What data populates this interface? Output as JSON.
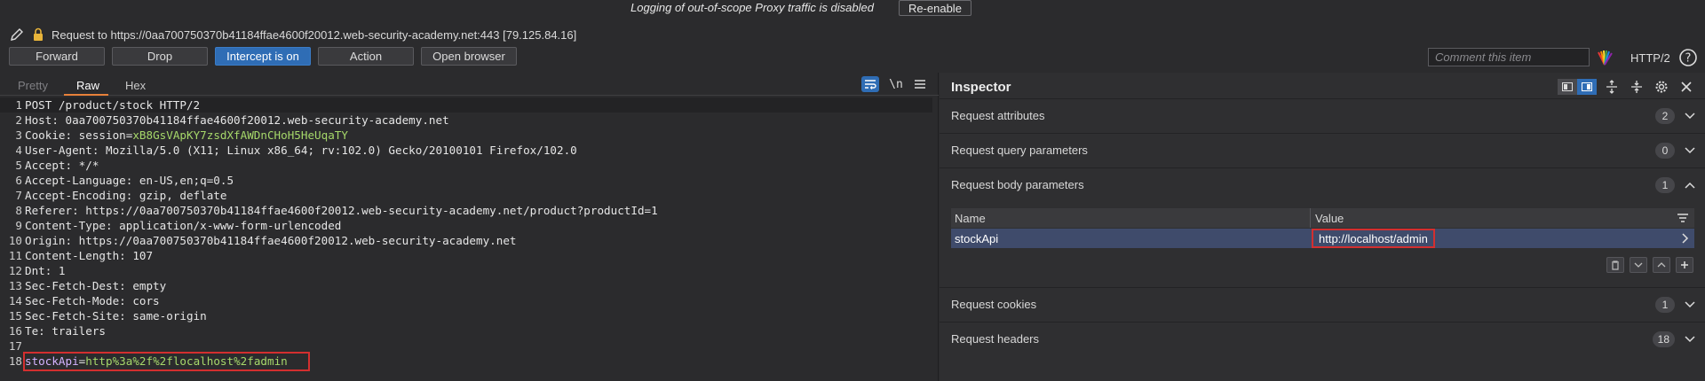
{
  "notice": {
    "text": "Logging of out-of-scope Proxy traffic is disabled",
    "reenable_label": "Re-enable"
  },
  "request": {
    "line": "Request to https://0aa700750370b41184ffae4600f20012.web-security-academy.net:443  [79.125.84.16]"
  },
  "toolbar": {
    "forward": "Forward",
    "drop": "Drop",
    "intercept": "Intercept is on",
    "action": "Action",
    "open_browser": "Open browser",
    "comment_placeholder": "Comment this item",
    "protocol": "HTTP/2"
  },
  "editor": {
    "tabs": [
      "Pretty",
      "Raw",
      "Hex"
    ],
    "active_tab": "Raw",
    "newline_label": "\\n",
    "lines": [
      {
        "n": "1",
        "text": "POST /product/stock HTTP/2"
      },
      {
        "n": "2",
        "text": "Host: 0aa700750370b41184ffae4600f20012.web-security-academy.net"
      },
      {
        "n": "3",
        "key": "Cookie: session=",
        "value": "xB8GsVApKY7zsdXfAWDnCHoH5HeUqaTY"
      },
      {
        "n": "4",
        "text": "User-Agent: Mozilla/5.0 (X11; Linux x86_64; rv:102.0) Gecko/20100101 Firefox/102.0"
      },
      {
        "n": "5",
        "text": "Accept: */*"
      },
      {
        "n": "6",
        "text": "Accept-Language: en-US,en;q=0.5"
      },
      {
        "n": "7",
        "text": "Accept-Encoding: gzip, deflate"
      },
      {
        "n": "8",
        "text": "Referer: https://0aa700750370b41184ffae4600f20012.web-security-academy.net/product?productId=1"
      },
      {
        "n": "9",
        "text": "Content-Type: application/x-www-form-urlencoded"
      },
      {
        "n": "10",
        "text": "Origin: https://0aa700750370b41184ffae4600f20012.web-security-academy.net"
      },
      {
        "n": "11",
        "text": "Content-Length: 107"
      },
      {
        "n": "12",
        "text": "Dnt: 1"
      },
      {
        "n": "13",
        "text": "Sec-Fetch-Dest: empty"
      },
      {
        "n": "14",
        "text": "Sec-Fetch-Mode: cors"
      },
      {
        "n": "15",
        "text": "Sec-Fetch-Site: same-origin"
      },
      {
        "n": "16",
        "text": "Te: trailers"
      },
      {
        "n": "17",
        "text": ""
      },
      {
        "n": "18",
        "key": "stockApi",
        "sep": "=",
        "value": "http%3a%2f%2flocalhost%2fadmin"
      }
    ]
  },
  "inspector": {
    "title": "Inspector",
    "sections": [
      {
        "label": "Request attributes",
        "count": "2"
      },
      {
        "label": "Request query parameters",
        "count": "0"
      },
      {
        "label": "Request body parameters",
        "count": "1"
      },
      {
        "label": "Request cookies",
        "count": "1"
      },
      {
        "label": "Request headers",
        "count": "18"
      }
    ],
    "table": {
      "col_name": "Name",
      "col_value": "Value",
      "row_name": "stockApi",
      "row_value": "http://localhost/admin"
    }
  }
}
